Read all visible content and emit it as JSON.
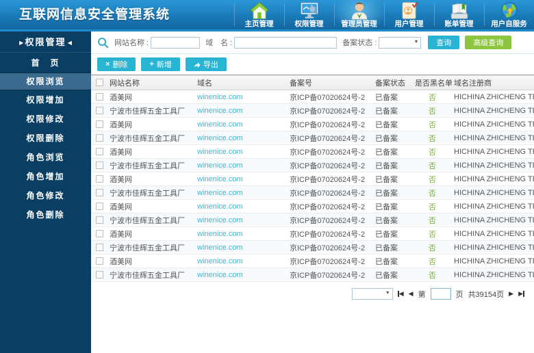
{
  "app": {
    "title": "互联网信息安全管理系统"
  },
  "top_nav": {
    "items": [
      {
        "label": "主页管理",
        "icon": "home-icon",
        "active": false
      },
      {
        "label": "权限管理",
        "icon": "monitor-search-icon",
        "active": false
      },
      {
        "label": "管理员管理",
        "icon": "admin-person-icon",
        "active": true
      },
      {
        "label": "用户管理",
        "icon": "user-card-icon",
        "active": false
      },
      {
        "label": "账单管理",
        "icon": "ledger-book-icon",
        "active": false
      },
      {
        "label": "用户自服务",
        "icon": "globe-icon",
        "active": false
      }
    ]
  },
  "sidebar": {
    "header": "权限管理",
    "items": [
      {
        "label": "首　页",
        "active": false
      },
      {
        "label": "权限浏览",
        "active": true
      },
      {
        "label": "权限增加",
        "active": false
      },
      {
        "label": "权限修改",
        "active": false
      },
      {
        "label": "权限删除",
        "active": false
      },
      {
        "label": "角色浏览",
        "active": false
      },
      {
        "label": "角色增加",
        "active": false
      },
      {
        "label": "角色修改",
        "active": false
      },
      {
        "label": "角色删除",
        "active": false
      }
    ]
  },
  "search": {
    "site_name_label": "网站名称 :",
    "site_name_value": "",
    "domain_label": "域　名 :",
    "domain_value": "",
    "status_label": "备案状态 :",
    "status_value": "",
    "query_button": "查询",
    "advanced_query_button": "高级查询"
  },
  "toolbar": {
    "delete_button": "删除",
    "add_button": "新增",
    "export_button": "导出"
  },
  "table": {
    "columns": [
      "网站名称",
      "域名",
      "备案号",
      "备案状态",
      "是否黑名单",
      "域名注册商"
    ],
    "rows": [
      {
        "name": "酒美网",
        "domain": "winenice.com",
        "record": "京ICP备07020624号-2",
        "status": "已备案",
        "blacklist": "否",
        "registrar": "HICHINA ZHICHENG TECHNOLOGY"
      },
      {
        "name": "宁波市佳辉五金工具厂",
        "domain": "winenice.com",
        "record": "京ICP备07020624号-2",
        "status": "已备案",
        "blacklist": "否",
        "registrar": "HICHINA ZHICHENG TECHNOLOGY"
      },
      {
        "name": "酒美网",
        "domain": "winenice.com",
        "record": "京ICP备07020624号-2",
        "status": "已备案",
        "blacklist": "否",
        "registrar": "HICHINA ZHICHENG TECHNOLOGY"
      },
      {
        "name": "宁波市佳辉五金工具厂",
        "domain": "winenice.com",
        "record": "京ICP备07020624号-2",
        "status": "已备案",
        "blacklist": "否",
        "registrar": "HICHINA ZHICHENG TECHNOLOGY"
      },
      {
        "name": "酒美网",
        "domain": "winenice.com",
        "record": "京ICP备07020624号-2",
        "status": "已备案",
        "blacklist": "否",
        "registrar": "HICHINA ZHICHENG TECHNOLOGY"
      },
      {
        "name": "宁波市佳辉五金工具厂",
        "domain": "winenice.com",
        "record": "京ICP备07020624号-2",
        "status": "已备案",
        "blacklist": "否",
        "registrar": "HICHINA ZHICHENG TECHNOLOGY"
      },
      {
        "name": "酒美网",
        "domain": "winenice.com",
        "record": "京ICP备07020624号-2",
        "status": "已备案",
        "blacklist": "否",
        "registrar": "HICHINA ZHICHENG TECHNOLOGY"
      },
      {
        "name": "宁波市佳辉五金工具厂",
        "domain": "winenice.com",
        "record": "京ICP备07020624号-2",
        "status": "已备案",
        "blacklist": "否",
        "registrar": "HICHINA ZHICHENG TECHNOLOGY"
      },
      {
        "name": "酒美网",
        "domain": "winenice.com",
        "record": "京ICP备07020624号-2",
        "status": "已备案",
        "blacklist": "否",
        "registrar": "HICHINA ZHICHENG TECHNOLOGY"
      },
      {
        "name": "宁波市佳辉五金工具厂",
        "domain": "winenice.com",
        "record": "京ICP备07020624号-2",
        "status": "已备案",
        "blacklist": "否",
        "registrar": "HICHINA ZHICHENG TECHNOLOGY"
      },
      {
        "name": "酒美网",
        "domain": "winenice.com",
        "record": "京ICP备07020624号-2",
        "status": "已备案",
        "blacklist": "否",
        "registrar": "HICHINA ZHICHENG TECHNOLOGY"
      },
      {
        "name": "宁波市佳辉五金工具厂",
        "domain": "winenice.com",
        "record": "京ICP备07020624号-2",
        "status": "已备案",
        "blacklist": "否",
        "registrar": "HICHINA ZHICHENG TECHNOLOGY"
      },
      {
        "name": "酒美网",
        "domain": "winenice.com",
        "record": "京ICP备07020624号-2",
        "status": "已备案",
        "blacklist": "否",
        "registrar": "HICHINA ZHICHENG TECHNOLOGY"
      },
      {
        "name": "宁波市佳辉五金工具厂",
        "domain": "winenice.com",
        "record": "京ICP备07020624号-2",
        "status": "已备案",
        "blacklist": "否",
        "registrar": "HICHINA ZHICHENG TECHNOLOGY"
      }
    ]
  },
  "pagination": {
    "page_size_value": "",
    "page_label_prefix": "第",
    "page_input_value": "",
    "page_label_suffix": "页",
    "total_pages": "共39154页"
  },
  "colors": {
    "header_blue": "#1b7fc0",
    "sidebar_navy": "#0a3e62",
    "accent_cyan": "#2ab4d4",
    "accent_green": "#8cc63e",
    "link_cyan": "#3ab7d9",
    "blacklist_green": "#7cb342"
  }
}
